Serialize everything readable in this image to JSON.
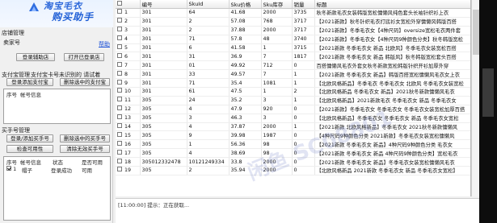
{
  "app": {
    "logo_top": "淘宝毛衣",
    "logo_title": "购买助手"
  },
  "shop": {
    "group_label": "店铺管理",
    "seller_label": "卖家号",
    "help_link": "帮助",
    "login_shop_button": "登录辅助店",
    "open_login_button": "打开已登录店"
  },
  "payment": {
    "group_label": "支付宝管理",
    "group_label2": "支付宝卡号未识别的 请试着",
    "add_card_button": "登录添加支付宝",
    "delete_card_button": "删除选中的支付宝",
    "col_index": "序号",
    "col_account": "帐号信息"
  },
  "buyer": {
    "group_label": "买手号管理",
    "add_buyer_button": "登录/添加买手号",
    "delete_buyer_button": "删除选中的买手号",
    "check_button": "检查可用性",
    "clear_button": "清除无效买手号",
    "cols": [
      "序号",
      "帐号信息",
      "状态",
      "是否可用"
    ],
    "rows": [
      {
        "index": "1",
        "account": "帽子",
        "status": "登录成功",
        "available": "可用",
        "checked": true
      }
    ]
  },
  "table": {
    "headers": [
      "",
      "编号",
      "SkuId",
      "Sku价格",
      "Sku库存",
      "销量",
      "标题"
    ],
    "rows": [
      {
        "n": "1",
        "id": "301",
        "sku": "64",
        "price": "41.68",
        "stock": "2000",
        "sales": "3735",
        "title": "秋冬新款毛衣女装韩版宽松慵懒风纯色套头长袖针织衫上衣"
      },
      {
        "n": "2",
        "id": "301",
        "sku": "2",
        "price": "57.08",
        "stock": "768",
        "sales": "3717",
        "title": "【2021新款】秋冬针织毛衣打底衫女宽松外穿慵懒风韩版百搭"
      },
      {
        "n": "3",
        "id": "301",
        "sku": "2",
        "price": "37.88",
        "stock": "2000",
        "sales": "3717",
        "title": "【2021新款】冬季毛衣女【4种尺码】oversize宽松毛衣两件套"
      },
      {
        "n": "4",
        "id": "301",
        "sku": "71",
        "price": "57.8",
        "stock": "48",
        "sales": "3740",
        "title": "【2021新款】冬季毛衣女【4种尺码9种颜色分类】秋冬韩版宽松"
      },
      {
        "n": "5",
        "id": "301",
        "sku": "6",
        "price": "41.58",
        "stock": "1",
        "sales": "3715",
        "title": "【2021新款 冬季毛衣女 新品 北欧风】冬季毛衣女装宽松百搭"
      },
      {
        "n": "6",
        "id": "301",
        "sku": "31",
        "price": "36.9",
        "stock": "7",
        "sales": "1817",
        "title": "【2021新款 冬季毛衣女 新品 韩版风】秋冬韩版宽松套头百搭"
      },
      {
        "n": "7",
        "id": "301",
        "sku": "01",
        "price": "49.92",
        "stock": "712",
        "sales": "0",
        "title": "百搭慵懒风毛衣外套女秋冬新款宽松韩版针织开衫加厚外穿"
      },
      {
        "n": "8",
        "id": "301",
        "sku": "33",
        "price": "49.57",
        "stock": "7",
        "sales": "1",
        "title": "【2021新款 冬季毛衣女 新品】韩版百搭宽松慵懒风毛衣女上衣"
      },
      {
        "n": "9",
        "id": "301",
        "sku": "71",
        "price": "35.4",
        "stock": "1081",
        "sales": "1",
        "title": "【北欧风格新品】冬季毛衣 冬季毛衣女 北欧风 冬季毛衣女装宽松"
      },
      {
        "n": "10",
        "id": "301",
        "sku": "61",
        "price": "47.5",
        "stock": "1",
        "sales": "2",
        "title": "【北欧风格新品 冬季毛衣女 新品】2021秋冬新款慵懒风毛衣"
      },
      {
        "n": "11",
        "id": "305",
        "sku": "24",
        "price": "35.2",
        "stock": "3",
        "sales": "1",
        "title": "【北欧风格新品】2021新款毛衣 冬季毛衣女 新品 冬季毛衣女"
      },
      {
        "n": "12",
        "id": "305",
        "sku": "4",
        "price": "47.9",
        "stock": "920",
        "sales": "0",
        "title": "【2021新款】冬季毛衣女 冬季毛衣女 冬季毛衣女装宽松加厚百搭"
      },
      {
        "n": "13",
        "id": "305",
        "sku": "3",
        "price": "46.3",
        "stock": "3",
        "sales": "0",
        "title": "【北欧风格新品】冬季毛衣女 冬季毛衣女 新品 冬季毛衣女宽松"
      },
      {
        "n": "14",
        "id": "305",
        "sku": "4",
        "price": "37.87",
        "stock": "2000",
        "sales": "1",
        "title": "【2021新款 北欧风格新品】冬季毛衣女 2021秋冬新款慵懒风"
      },
      {
        "n": "15",
        "id": "305",
        "sku": "9",
        "price": "39.98",
        "stock": "1987",
        "sales": "0",
        "title": "【4种尺码9种颜色分类 2021新款】冬季毛衣女装宽松慵懒风"
      },
      {
        "n": "16",
        "id": "305",
        "sku": "1",
        "price": "56.36",
        "stock": "98",
        "sales": "0",
        "title": "【2021新款 冬季毛衣女 新品】4种尺码9种颜色分类 毛衣女"
      },
      {
        "n": "17",
        "id": "305",
        "sku": "4",
        "price": "38.69",
        "stock": "98",
        "sales": "0",
        "title": "【2021新款 冬季毛衣女 新品 4种尺码9种颜色分类】宽松毛衣"
      },
      {
        "n": "18",
        "id": "305012332478",
        "sku": "10121249334",
        "price": "33.8",
        "stock": "2000",
        "sales": "0",
        "title": "【2021新款 冬季毛衣女 新品】冬季毛衣女装宽松慵懒风毛衣"
      },
      {
        "n": "19",
        "id": "305",
        "sku": "2",
        "price": "35.94",
        "stock": "2000",
        "sales": "0",
        "title": "【北欧风格新品 2021新款 冬季毛衣女 新品 冬季毛衣女宽松】"
      }
    ]
  },
  "status_bar": {
    "text": "[11:00:00] 提示：正在获取..."
  },
  "watermark": "闲鱼 SC08801"
}
